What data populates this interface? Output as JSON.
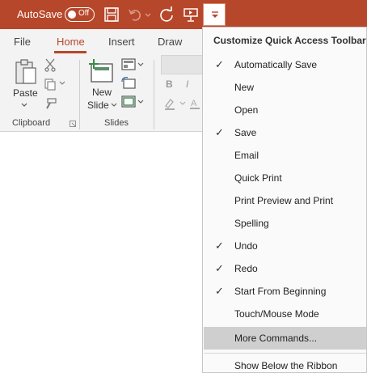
{
  "titlebar": {
    "autosave_label": "AutoSave",
    "autosave_state": "Off",
    "accent_color": "#b7472a"
  },
  "ribbon": {
    "tabs": [
      "File",
      "Home",
      "Insert",
      "Draw"
    ],
    "active_tab": "Home",
    "clipboard": {
      "paste_label": "Paste",
      "group_label": "Clipboard"
    },
    "slides": {
      "new_slide_line1": "New",
      "new_slide_line2": "Slide",
      "group_label": "Slides"
    },
    "font": {
      "bold": "B",
      "italic": "I"
    }
  },
  "menu": {
    "title": "Customize Quick Access Toolbar",
    "check_glyph": "✓",
    "items": [
      {
        "label": "Automatically Save",
        "checked": true
      },
      {
        "label": "New",
        "checked": false
      },
      {
        "label": "Open",
        "checked": false
      },
      {
        "label": "Save",
        "checked": true
      },
      {
        "label": "Email",
        "checked": false
      },
      {
        "label": "Quick Print",
        "checked": false
      },
      {
        "label": "Print Preview and Print",
        "checked": false
      },
      {
        "label": "Spelling",
        "checked": false
      },
      {
        "label": "Undo",
        "checked": true
      },
      {
        "label": "Redo",
        "checked": true
      },
      {
        "label": "Start From Beginning",
        "checked": true
      },
      {
        "label": "Touch/Mouse Mode",
        "checked": false
      },
      {
        "label": "More Commands...",
        "checked": false,
        "highlighted": true
      },
      {
        "label": "Show Below the Ribbon",
        "checked": false
      }
    ]
  }
}
